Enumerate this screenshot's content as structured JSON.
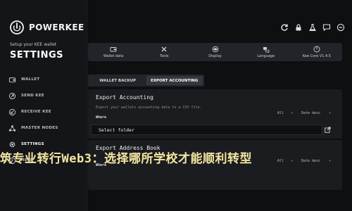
{
  "app": {
    "brand": "POWERKEE",
    "setup_text": "Setup your KEE wallet",
    "section_title": "SETTINGS"
  },
  "sidebar": {
    "items": [
      {
        "label": "WALLET",
        "icon": "wallet-icon"
      },
      {
        "label": "SEND KEE",
        "icon": "send-icon"
      },
      {
        "label": "RECEIVE KEE",
        "icon": "receive-icon"
      },
      {
        "label": "MASTER NODES",
        "icon": "nodes-icon"
      },
      {
        "label": "SETTINGS",
        "icon": "gear-icon"
      },
      {
        "label": "HELP",
        "icon": "help-icon"
      }
    ]
  },
  "topbar": {
    "icons": [
      "refresh-icon",
      "lock-icon",
      "flask-icon",
      "chat-icon",
      "minimize-icon"
    ]
  },
  "tabs": [
    {
      "label": "Wallet data",
      "icon": "wallet-data-icon"
    },
    {
      "label": "Tools",
      "icon": "tools-icon"
    },
    {
      "label": "Display",
      "icon": "display-icon"
    },
    {
      "label": "Language",
      "icon": "language-icon"
    },
    {
      "label": "Kee Core V1.4.5",
      "icon": "kee-core-icon"
    }
  ],
  "subtabs": {
    "wallet_backup": "WALLET BACKUP",
    "export_accounting": "EXPORT ACCOUNTING",
    "active": "export_accounting"
  },
  "export_accounting": {
    "title": "Export Accounting",
    "description": "Export your wallets accounting data to a CSV file.",
    "where_label": "Where",
    "filter_value": "All",
    "sort_value": "Date desc",
    "folder_placeholder": "Select folder"
  },
  "export_address_book": {
    "title": "Export Address Book",
    "where_label": "Where",
    "filter_value": "All",
    "sort_value": "Date desc"
  },
  "overlay": {
    "headline": "筑专业转行Web3：选择哪所学校才能顺利转型"
  },
  "colors": {
    "background": "#0e0f11",
    "sidebar": "#141518",
    "card": "#1a1c20",
    "overlay_text": "#f5e7a0"
  }
}
